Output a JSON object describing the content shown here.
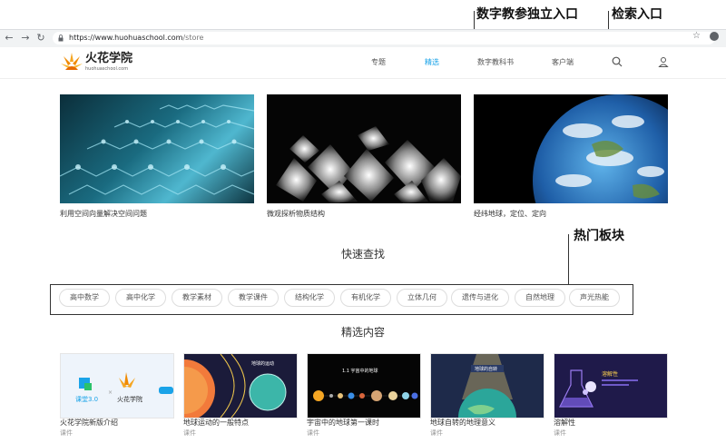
{
  "annotations": {
    "digital_textbook": "数字教参独立入口",
    "search_entry": "检索入口",
    "hot_sections": "热门板块"
  },
  "browser": {
    "url_host": "https://www.huohuaschool.com",
    "url_path": "/store"
  },
  "header": {
    "logo_name": "火花学院",
    "logo_domain": "huohuaschool.com",
    "menu": [
      "专题",
      "精选",
      "数字教科书",
      "客户端"
    ],
    "active_menu": "精选",
    "accent_color": "#1aa3e8"
  },
  "featured": [
    {
      "caption": "利用空间向量解决空间问题"
    },
    {
      "caption": "微观探析物质结构"
    },
    {
      "caption": "经纬地球，定位、定向"
    }
  ],
  "quick_search": {
    "title": "快速查找",
    "tags": [
      "高中数学",
      "高中化学",
      "教学素材",
      "教学课件",
      "结构化学",
      "有机化学",
      "立体几何",
      "遗传与进化",
      "自然地理",
      "声光热能"
    ]
  },
  "selected": {
    "title": "精选内容",
    "items": [
      {
        "title": "火花学院新版介绍",
        "type": "课件",
        "thumb_text": [
          "课堂3.0",
          "火花学院"
        ]
      },
      {
        "title": "地球运动的一般特点",
        "type": "课件"
      },
      {
        "title": "宇宙中的地球第一课时",
        "type": "课件",
        "thumb_text": [
          "1.1 宇宙中的地球"
        ]
      },
      {
        "title": "地球自转的地理意义",
        "type": "课件"
      },
      {
        "title": "溶解性",
        "type": "课件",
        "thumb_text": [
          "溶解性"
        ]
      }
    ]
  }
}
